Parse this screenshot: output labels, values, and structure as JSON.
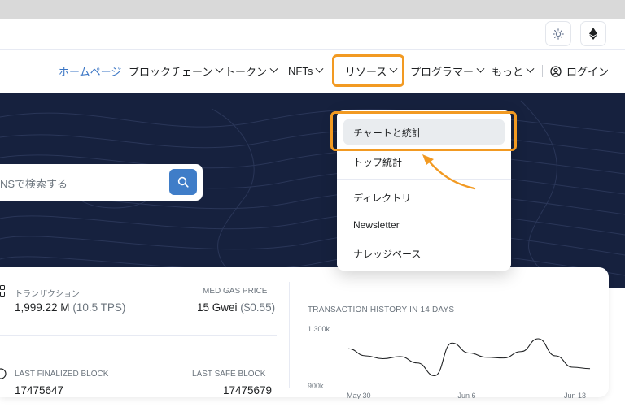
{
  "topbar": {
    "theme_icon": "sun-icon",
    "network_icon": "ethereum-icon"
  },
  "nav": {
    "items": [
      {
        "label": "ホームページ",
        "active": true
      },
      {
        "label": "ブロックチェーン"
      },
      {
        "label": "トークン"
      },
      {
        "label": "NFTs"
      },
      {
        "label": "リソース"
      },
      {
        "label": "プログラマー"
      },
      {
        "label": "もっと"
      }
    ],
    "login_label": "ログイン"
  },
  "search": {
    "placeholder": "NSで検索する"
  },
  "dropdown": {
    "items": [
      {
        "label": "チャートと統計"
      },
      {
        "label": "トップ統計"
      },
      {
        "label": "ディレクトリ"
      },
      {
        "label": "Newsletter"
      },
      {
        "label": "ナレッジベース"
      }
    ]
  },
  "stats": {
    "transactions": {
      "label": "トランザクション",
      "value": "1,999.22 M",
      "sub": "(10.5 TPS)"
    },
    "gas": {
      "label": "MED GAS PRICE",
      "value": "15 Gwei",
      "sub": "($0.55)"
    },
    "finalized": {
      "label": "LAST FINALIZED BLOCK",
      "value": "17475647"
    },
    "safe": {
      "label": "LAST SAFE BLOCK",
      "value": "17475679"
    }
  },
  "chart_data": {
    "type": "line",
    "title": "TRANSACTION HISTORY IN 14 DAYS",
    "y_tick_labels": [
      "1 300k",
      "900k"
    ],
    "x_tick_labels": [
      "May 30",
      "Jun 6",
      "Jun 13"
    ],
    "ylim": [
      900000,
      1300000
    ],
    "x": [
      "May 30",
      "May 31",
      "Jun 1",
      "Jun 2",
      "Jun 3",
      "Jun 4",
      "Jun 5",
      "Jun 6",
      "Jun 7",
      "Jun 8",
      "Jun 9",
      "Jun 10",
      "Jun 11",
      "Jun 12",
      "Jun 13"
    ],
    "series": [
      {
        "values": [
          1150000,
          1100000,
          1080000,
          1095000,
          1050000,
          960000,
          1190000,
          1120000,
          1090000,
          1085000,
          1130000,
          1220000,
          1100000,
          1020000,
          1010000
        ]
      }
    ],
    "grid": false,
    "color": "#1e2022"
  },
  "colors": {
    "accent": "#3a75c4",
    "highlight": "#f29a22",
    "hero_bg": "#16213e"
  }
}
